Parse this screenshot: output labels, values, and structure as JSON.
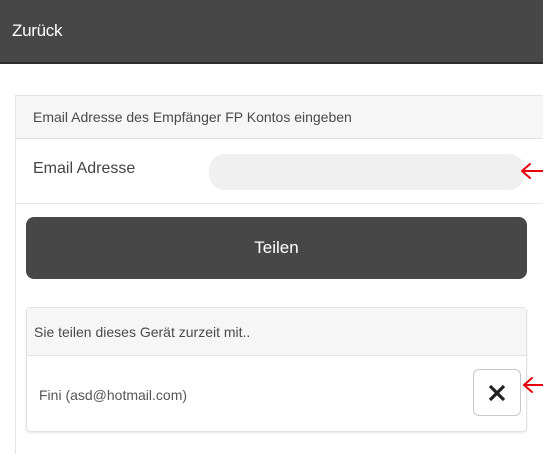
{
  "header": {
    "back_label": "Zurück"
  },
  "share_form": {
    "title": "Email Adresse des Empfänger FP Kontos eingeben",
    "email_label": "Email Adresse",
    "email_value": "",
    "email_placeholder": "",
    "share_button_label": "Teilen"
  },
  "shared_with": {
    "title": "Sie teilen dieses Gerät zurzeit mit..",
    "items": [
      {
        "label": "Fini (asd@hotmail.com)",
        "remove_icon": "close-x-icon"
      }
    ]
  },
  "annotations": {
    "arrow_color": "#e8000b"
  },
  "colors": {
    "topbar": "#474747",
    "button": "#474747",
    "panel_header": "#f6f6f6",
    "input_bg": "#f0f0f0"
  }
}
